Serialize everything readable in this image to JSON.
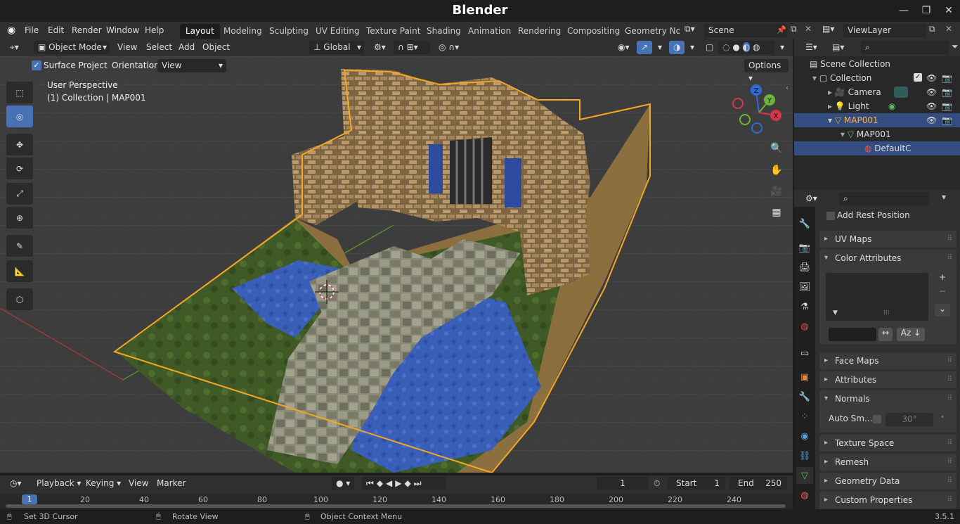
{
  "app": {
    "title": "Blender",
    "version": "3.5.1"
  },
  "menus": [
    "File",
    "Edit",
    "Render",
    "Window",
    "Help"
  ],
  "workspaces": [
    "Layout",
    "Modeling",
    "Sculpting",
    "UV Editing",
    "Texture Paint",
    "Shading",
    "Animation",
    "Rendering",
    "Compositing",
    "Geometry Noc"
  ],
  "active_workspace": "Layout",
  "scene": {
    "name": "Scene",
    "view_layer": "ViewLayer"
  },
  "viewport_header": {
    "mode": "Object Mode",
    "menus": [
      "View",
      "Select",
      "Add",
      "Object"
    ],
    "orientation": "Global"
  },
  "tool_options": {
    "surface_project_label": "Surface Project",
    "surface_project_checked": true,
    "orientation_label": "Orientation:",
    "orientation_value": "View",
    "options_label": "Options"
  },
  "viewport": {
    "perspective": "User Perspective",
    "collection_info": "(1) Collection | MAP001",
    "axes": {
      "x": "X",
      "y": "Y",
      "z": "Z"
    }
  },
  "colors": {
    "accent": "#4772b3",
    "selection_outline": "#f5a623",
    "water": "#3a5fb8",
    "grass": "#3f5a26",
    "stone": "#8c8c78",
    "brick": "#a98a5c"
  },
  "timeline": {
    "menus": [
      "Playback",
      "Keying",
      "View",
      "Marker"
    ],
    "current_frame": "1",
    "start_label": "Start",
    "start": "1",
    "end_label": "End",
    "end": "250",
    "ticks": [
      "1",
      "20",
      "40",
      "60",
      "80",
      "100",
      "120",
      "140",
      "160",
      "180",
      "200",
      "220",
      "240"
    ]
  },
  "statusbar": {
    "left": "Set 3D Cursor",
    "middle": "Rotate View",
    "right": "Object Context Menu",
    "version": "3.5.1"
  },
  "outliner": {
    "items": [
      {
        "label": "Scene Collection",
        "indent": 0,
        "icon": "scene-collection-icon"
      },
      {
        "label": "Collection",
        "indent": 1,
        "icon": "collection-icon"
      },
      {
        "label": "Camera",
        "indent": 2,
        "icon": "camera-icon"
      },
      {
        "label": "Light",
        "indent": 2,
        "icon": "light-icon"
      },
      {
        "label": "MAP001",
        "indent": 2,
        "icon": "mesh-object-icon"
      },
      {
        "label": "MAP001",
        "indent": 3,
        "icon": "mesh-data-icon"
      },
      {
        "label": "DefaultC",
        "indent": 4,
        "icon": "material-icon"
      }
    ]
  },
  "properties": {
    "add_rest_position": "Add Rest Position",
    "panels": [
      "UV Maps",
      "Color Attributes",
      "Face Maps",
      "Attributes",
      "Normals",
      "Texture Space",
      "Remesh",
      "Geometry Data",
      "Custom Properties"
    ],
    "auto_smooth_label": "Auto Sm...",
    "auto_smooth_angle": "30°"
  }
}
